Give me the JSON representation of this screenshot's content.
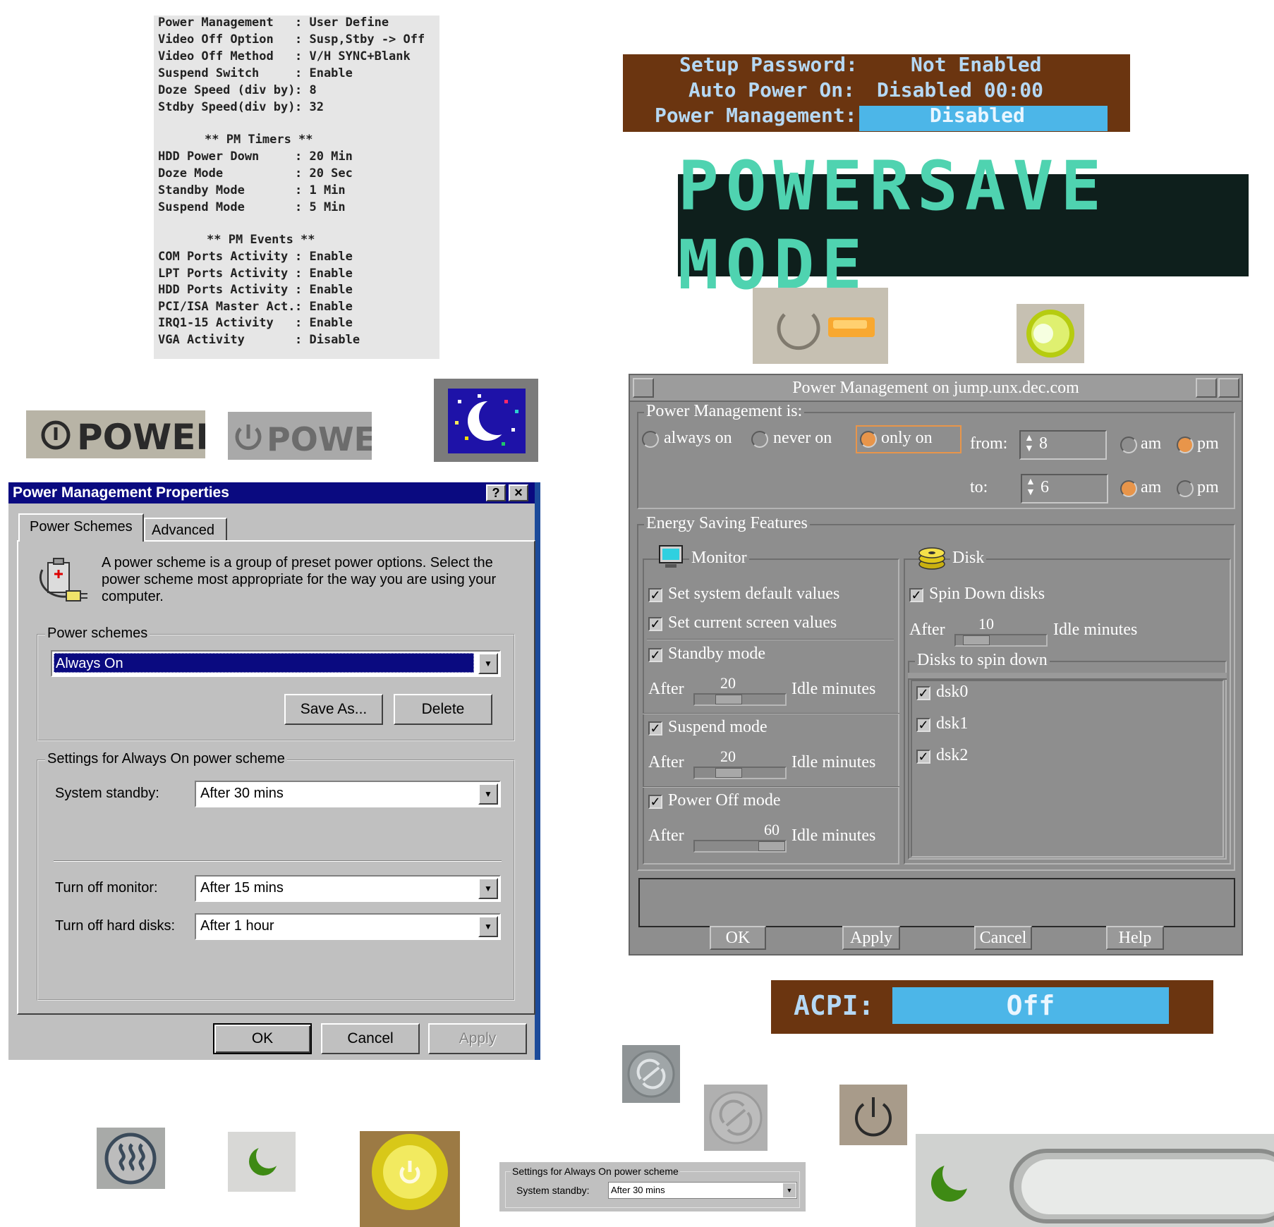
{
  "bios": {
    "lines": [
      [
        "Power Management",
        ": User Define"
      ],
      [
        "Video Off Option",
        ": Susp,Stby -> Off"
      ],
      [
        "Video Off Method",
        ": V/H SYNC+Blank"
      ],
      [
        "Suspend Switch",
        ": Enable"
      ],
      [
        "Doze Speed (div by)",
        ": 8"
      ],
      [
        "Stdby Speed(div by)",
        ": 32"
      ]
    ],
    "timers_header": "** PM Timers **",
    "timers": [
      [
        "HDD Power Down",
        ": 20 Min"
      ],
      [
        "Doze Mode",
        ": 20 Sec"
      ],
      [
        "Standby Mode",
        ": 1 Min"
      ],
      [
        "Suspend Mode",
        ": 5 Min"
      ]
    ],
    "events_header": "** PM Events **",
    "events": [
      [
        "COM Ports Activity",
        ": Enable"
      ],
      [
        "LPT Ports Activity",
        ": Enable"
      ],
      [
        "HDD Ports Activity",
        ": Enable"
      ],
      [
        "PCI/ISA Master Act.",
        ": Enable"
      ],
      [
        "IRQ1-15 Activity",
        ": Enable"
      ],
      [
        "VGA Activity",
        ": Disable"
      ]
    ]
  },
  "setup": {
    "setup_password_label": "Setup Password:",
    "setup_password_value": "Not Enabled",
    "auto_power_label": "Auto Power On:",
    "auto_power_value": "Disabled 00:00",
    "power_mgmt_label": "Power Management:",
    "power_mgmt_value": "Disabled"
  },
  "vfd_text": "POWERSAVE MODE",
  "power_buttons": {
    "left": "POWER",
    "right": "POWER"
  },
  "win": {
    "title": "Power Management Properties",
    "help": "?",
    "close": "×",
    "tabs": [
      "Power Schemes",
      "Advanced"
    ],
    "description": "A power scheme is a group of preset power options. Select the power scheme most appropriate for the way you are using your computer.",
    "schemes_group": "Power schemes",
    "scheme_selected": "Always On",
    "save_as": "Save As...",
    "delete": "Delete",
    "settings_group": "Settings for Always On power scheme",
    "system_standby_label": "System standby:",
    "system_standby_value": "After 30 mins",
    "turn_off_monitor_label": "Turn off monitor:",
    "turn_off_monitor_value": "After 15 mins",
    "turn_off_disks_label": "Turn off hard disks:",
    "turn_off_disks_value": "After 1 hour",
    "ok": "OK",
    "cancel": "Cancel",
    "apply": "Apply"
  },
  "motif": {
    "title": "Power Management on jump.unx.dec.com",
    "pm_is_group": "Power Management is:",
    "always_on": "always on",
    "never_on": "never on",
    "only_on": "only on",
    "from_label": "from:",
    "from_value": "8",
    "to_label": "to:",
    "to_value": "6",
    "am": "am",
    "pm": "pm",
    "energy_group": "Energy Saving Features",
    "monitor_group": "Monitor",
    "disk_group": "Disk",
    "set_system_default": "Set system default values",
    "set_current_screen": "Set current screen values",
    "standby_mode": "Standby mode",
    "suspend_mode": "Suspend mode",
    "power_off_mode": "Power Off mode",
    "after": "After",
    "idle_minutes": "Idle minutes",
    "standby_value": "20",
    "suspend_value": "20",
    "power_off_value": "60",
    "spin_down_disks": "Spin Down disks",
    "disk_value": "10",
    "disks_group": "Disks to spin down",
    "disks": [
      "dsk0",
      "dsk1",
      "dsk2"
    ],
    "ok": "OK",
    "apply": "Apply",
    "cancel": "Cancel",
    "help": "Help",
    "check_mark": "✓"
  },
  "acpi": {
    "label": "ACPI:",
    "value": "Off"
  },
  "mini": {
    "group": "Settings for Always On power scheme",
    "system_standby_label": "System standby:",
    "system_standby_value": "After 30 mins"
  },
  "colors": {
    "win_title": "#0a0a80",
    "motif_bg": "#8e8e8e",
    "radio_on": "#e8954a",
    "vfd_text": "#4fd3b0",
    "bios_blue": "#4cb6e8"
  }
}
